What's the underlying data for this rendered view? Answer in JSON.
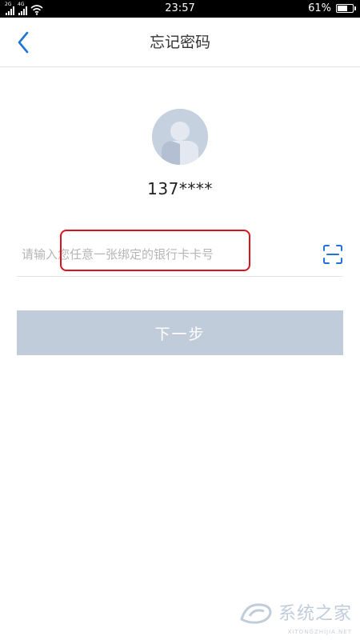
{
  "status_bar": {
    "network_1": "2G",
    "network_2": "4G",
    "time": "23:57",
    "battery_percent_text": "61%",
    "battery_level": 0.61
  },
  "nav": {
    "back_icon": "chevron-left-icon",
    "title": "忘记密码"
  },
  "account": {
    "avatar_icon": "user-avatar-icon",
    "phone_masked": "137****"
  },
  "form": {
    "card_input_value": "",
    "card_input_placeholder": "请输入您任意一张绑定的银行卡卡号",
    "scan_icon": "scan-icon"
  },
  "actions": {
    "next_label": "下一步"
  },
  "watermark": {
    "text": "系统之家",
    "sub": "XITONGZHIJIA.NET"
  },
  "colors": {
    "accent": "#1e74d6",
    "button_disabled": "#c1ccdb",
    "highlight": "#d9141f",
    "avatar_bg": "#c6d1e0"
  }
}
